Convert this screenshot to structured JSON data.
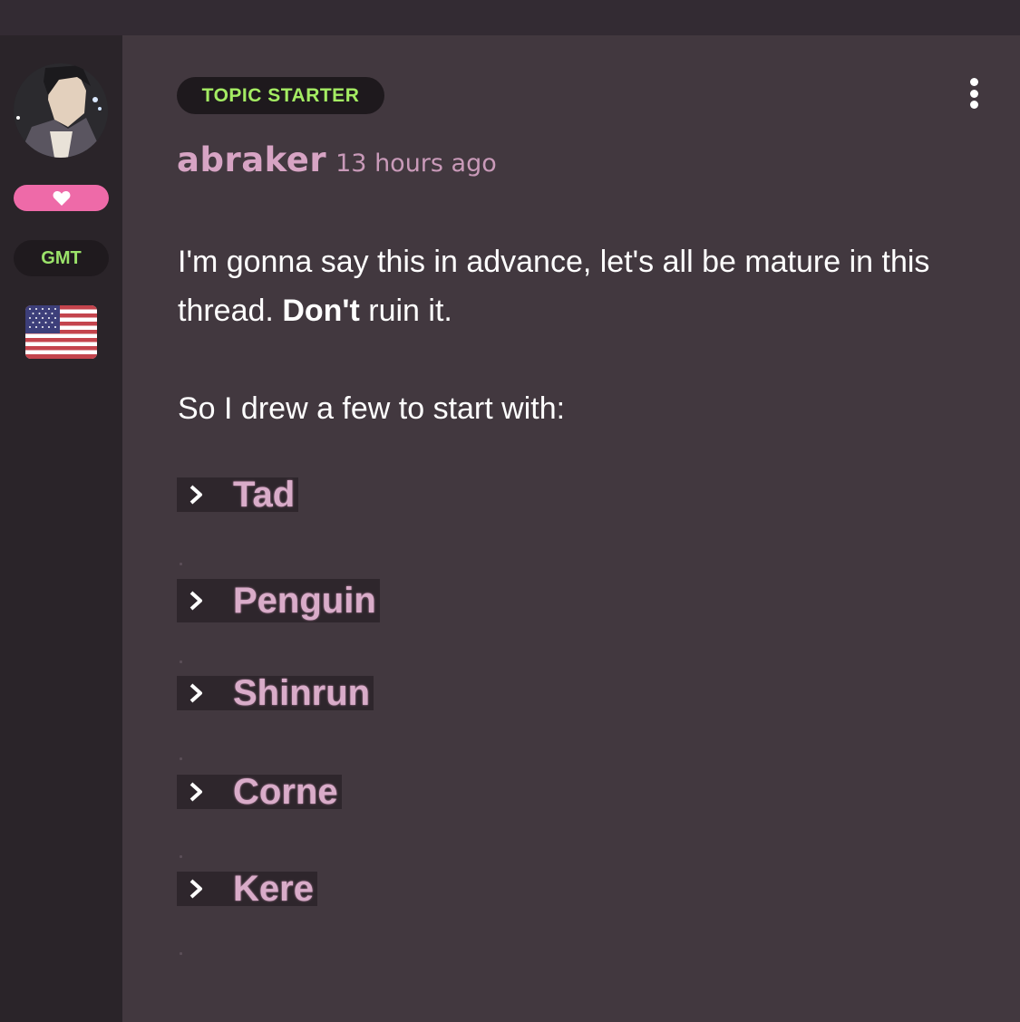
{
  "sidebar": {
    "timezone": "GMT"
  },
  "post": {
    "badge": "TOPIC STARTER",
    "username": "abraker",
    "timestamp": "13 hours ago",
    "paragraph1_prefix": "I'm gonna say this in advance, let's all be mature in this thread. ",
    "paragraph1_bold": "Don't",
    "paragraph1_suffix": " ruin it.",
    "paragraph2": "So I drew a few to start with:",
    "spoilers": [
      {
        "label": "Tad"
      },
      {
        "label": "Penguin"
      },
      {
        "label": "Shinrun"
      },
      {
        "label": "Corne"
      },
      {
        "label": "Kere"
      }
    ]
  },
  "colors": {
    "accent_green": "#a4ec63",
    "username_pink": "#d7a4c4",
    "heart_badge": "#ee6aa8"
  }
}
